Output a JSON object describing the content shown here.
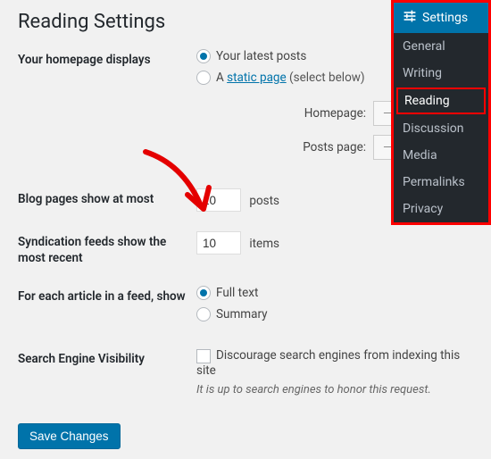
{
  "page_title": "Reading Settings",
  "rows": {
    "homepage": {
      "label": "Your homepage displays",
      "opt_latest": "Your latest posts",
      "opt_static_prefix": "A ",
      "opt_static_link": "static page",
      "opt_static_suffix": " (select below)",
      "homepage_label": "Homepage:",
      "postspage_label": "Posts page:",
      "select_placeholder": "— Select —"
    },
    "blogpages": {
      "label": "Blog pages show at most",
      "value": "10",
      "suffix": "posts"
    },
    "feeds": {
      "label": "Syndication feeds show the most recent",
      "value": "10",
      "suffix": "items"
    },
    "feedshow": {
      "label": "For each article in a feed, show",
      "opt_full": "Full text",
      "opt_summary": "Summary"
    },
    "sev": {
      "label": "Search Engine Visibility",
      "chk_label": "Discourage search engines from indexing this site",
      "desc": "It is up to search engines to honor this request."
    }
  },
  "save_label": "Save Changes",
  "sidebar": {
    "header": "Settings",
    "items": [
      {
        "label": "General"
      },
      {
        "label": "Writing"
      },
      {
        "label": "Reading"
      },
      {
        "label": "Discussion"
      },
      {
        "label": "Media"
      },
      {
        "label": "Permalinks"
      },
      {
        "label": "Privacy"
      }
    ]
  }
}
